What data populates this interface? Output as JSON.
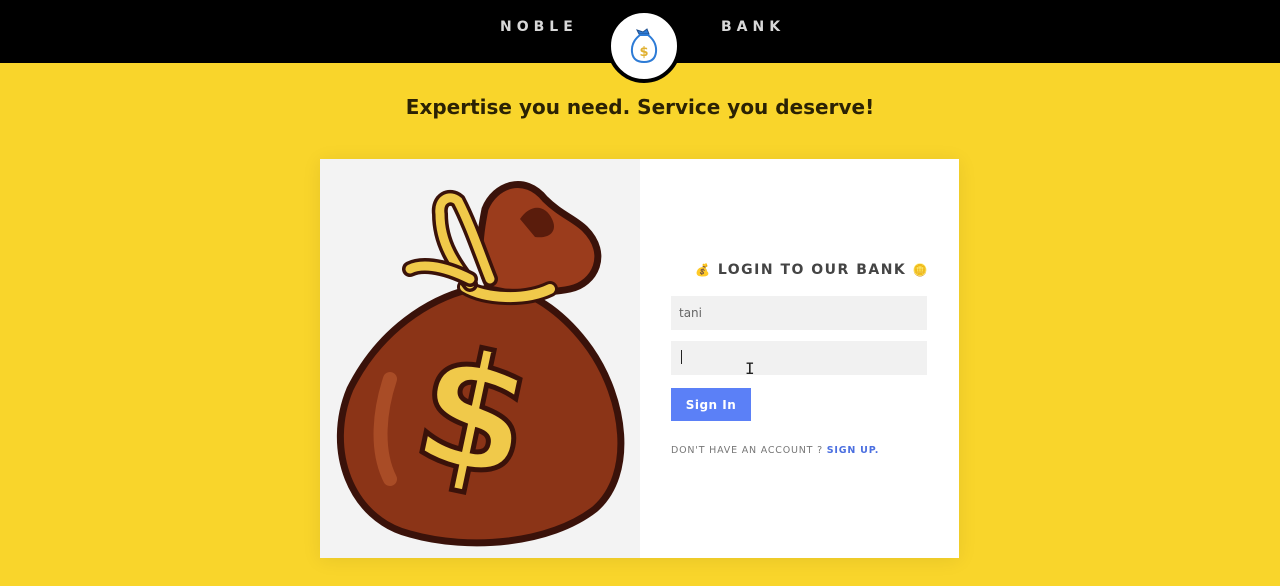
{
  "header": {
    "brand_left": "NOBLE",
    "brand_right": "BANK",
    "logo_icon": "money-bag-icon"
  },
  "tagline": "Expertise you need. Service you deserve!",
  "login": {
    "illustration_icon": "money-bag-dollar-icon",
    "title": "LOGIN TO OUR BANK",
    "title_left_emoji": "💰",
    "title_right_emoji": "🪙",
    "username_value": "tani",
    "password_value": "",
    "signin_label": "Sign In",
    "no_account_text": "DON'T HAVE AN ACCOUNT ?",
    "signup_link": "SIGN UP."
  },
  "colors": {
    "background": "#f9d52b",
    "header": "#000000",
    "button": "#5b80f7",
    "link": "#4b6fe0",
    "bag": "#8b3417",
    "dollar": "#f0c94a"
  }
}
